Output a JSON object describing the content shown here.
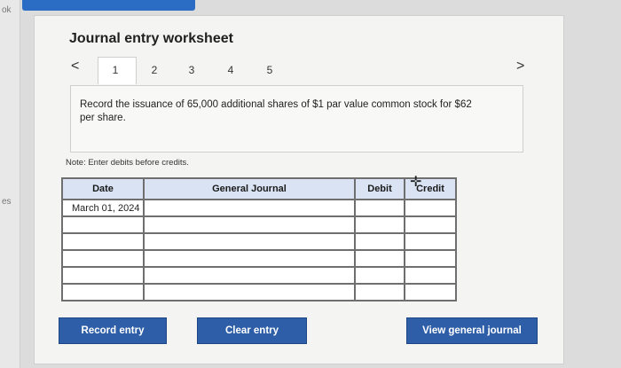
{
  "sidebar": {
    "text_top": "ok",
    "text_mid": "es"
  },
  "header": {
    "title": "Journal entry worksheet"
  },
  "tabs": {
    "prev": "<",
    "next": ">",
    "labels": [
      "1",
      "2",
      "3",
      "4",
      "5"
    ],
    "active": "1"
  },
  "prompt": {
    "text": "Record the issuance of 65,000 additional shares of $1 par value common stock for $62 per share."
  },
  "note": {
    "text": "Note: Enter debits before credits."
  },
  "table": {
    "headers": {
      "date": "Date",
      "journal": "General Journal",
      "debit": "Debit",
      "credit": "Credit"
    },
    "rows": [
      {
        "date": "March 01, 2024",
        "journal": "",
        "debit": "",
        "credit": ""
      },
      {
        "date": "",
        "journal": "",
        "debit": "",
        "credit": ""
      },
      {
        "date": "",
        "journal": "",
        "debit": "",
        "credit": ""
      },
      {
        "date": "",
        "journal": "",
        "debit": "",
        "credit": ""
      },
      {
        "date": "",
        "journal": "",
        "debit": "",
        "credit": ""
      },
      {
        "date": "",
        "journal": "",
        "debit": "",
        "credit": ""
      }
    ]
  },
  "buttons": {
    "record": "Record entry",
    "clear": "Clear entry",
    "view": "View general journal"
  },
  "colors": {
    "accent": "#2e5ea8",
    "header_bg": "#d9e3f3"
  }
}
